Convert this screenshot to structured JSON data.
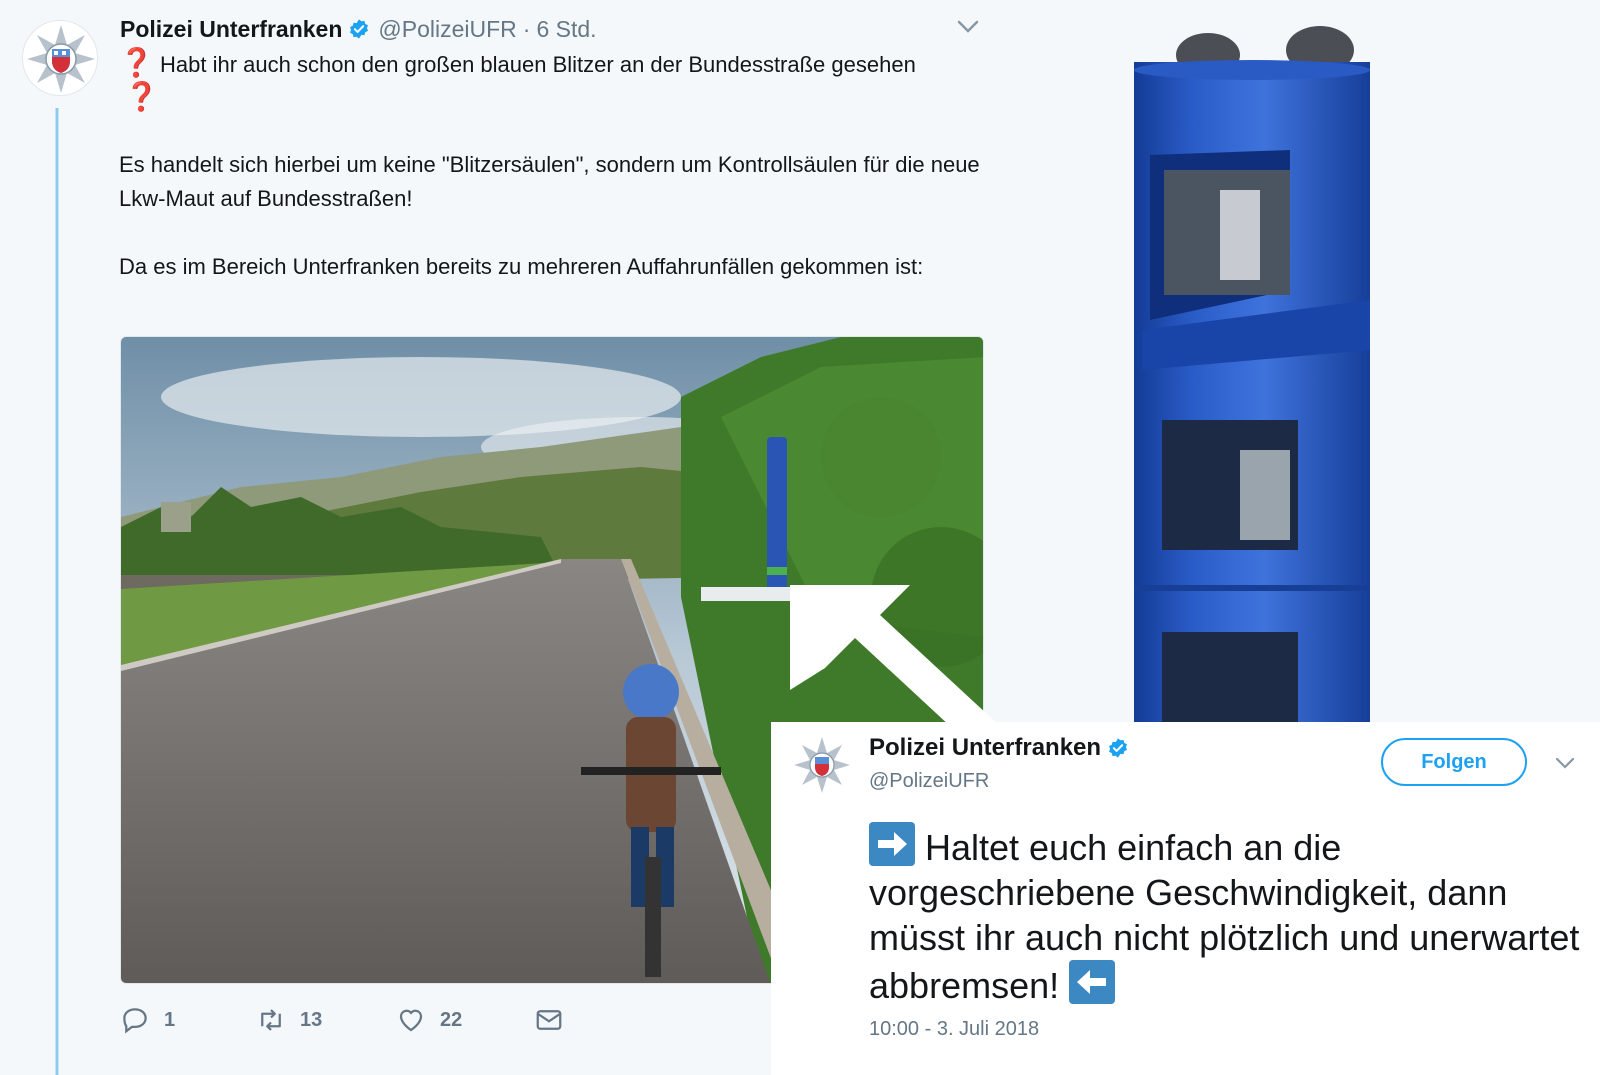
{
  "tweet": {
    "display_name": "Polizei Unterfranken",
    "handle": "@PolizeiUFR",
    "separator": "·",
    "time": "6 Std.",
    "line1": "Habt ihr auch schon den großen blauen Blitzer an der Bundesstraße gesehen",
    "question_mark": "❓",
    "para2": "Es handelt sich hierbei um keine \"Blitzersäulen\", sondern um Kontrollsäulen für die neue Lkw-Maut auf Bundesstraßen!",
    "para3": "Da es im Bereich Unterfranken bereits zu mehreren Auffahrunfällen gekommen ist:",
    "actions": {
      "replies": "1",
      "retweets": "13",
      "likes": "22"
    }
  },
  "card": {
    "display_name": "Polizei Unterfranken",
    "handle": "@PolizeiUFR",
    "follow_label": "Folgen",
    "text": "Haltet euch einfach an die vorgeschriebene Geschwindigkeit, dann müsst ihr auch nicht plötzlich und unerwartet abbremsen!",
    "timestamp": "10:00 - 3. Juli 2018"
  },
  "colors": {
    "accent": "#1da1f2",
    "muted": "#657786",
    "pillar_blue": "#1f4fb0",
    "emoji_blue": "#3b88c3"
  },
  "icons": [
    "verified-badge-icon",
    "chevron-down-icon",
    "reply-icon",
    "retweet-icon",
    "like-icon",
    "direct-message-icon",
    "arrow-right-emoji-icon",
    "arrow-left-emoji-icon",
    "police-badge-icon"
  ]
}
